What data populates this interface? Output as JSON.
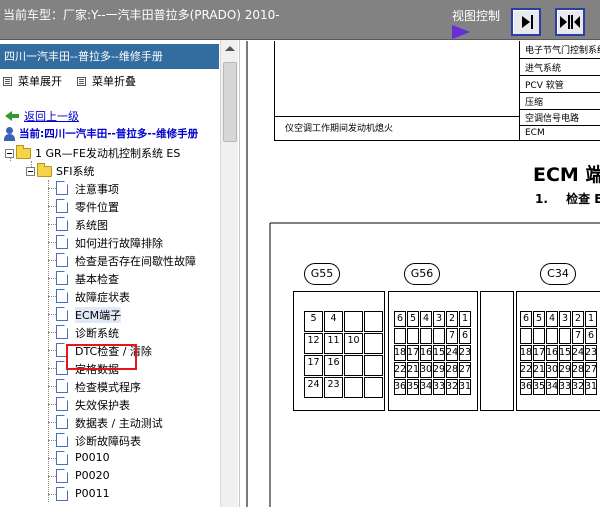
{
  "topbar": {
    "vehicle_label": "当前车型：厂家:Y--一汽丰田普拉多(PRADO) 2010-",
    "view_control_label": "视图控制",
    "btn_prev_icon": "arrow-right-bar-icon",
    "btn_fit_icon": "arrows-inward-icon"
  },
  "left_panel": {
    "header": "四川一汽丰田--普拉多--维修手册",
    "expand_label": "菜单展开",
    "collapse_label": "菜单折叠",
    "back_label": "返回上一级",
    "current_label": "当前:四川一汽丰田--普拉多--维修手册",
    "tree": {
      "root": "1 GR—FE发动机控制系统 ES",
      "folder": "SFI系统",
      "items": [
        "注意事项",
        "零件位置",
        "系统图",
        "如何进行故障排除",
        "检查是否存在间歇性故障",
        "基本检查",
        "故障症状表",
        "ECM端子",
        "诊断系统",
        "DTC检查 / 清除",
        "定格数据",
        "检查模式程序",
        "失效保护表",
        "数据表 / 主动测试",
        "诊断故障码表",
        "P0010",
        "P0020",
        "P0011"
      ],
      "selected_index": 7
    }
  },
  "document": {
    "spec_right": [
      "电子节气门控制系统",
      "进气系统",
      "PCV 软管",
      "压缩",
      "空调信号电路",
      "ECM"
    ],
    "spec_left": "仪空调工作期间发动机熄火",
    "title": "ECM 端",
    "step_num": "1.",
    "step_text": "检查 E",
    "connectors": [
      "G55",
      "G56",
      "C34"
    ],
    "g55_pins": [
      "5",
      "4",
      "",
      "",
      "12",
      "11",
      "10",
      "",
      "17",
      "16",
      "",
      "",
      "24",
      "23",
      "",
      ""
    ],
    "g56_pins": [
      "6",
      "5",
      "4",
      "3",
      "2",
      "1",
      "",
      "",
      "",
      "",
      "7",
      "6",
      "18",
      "17",
      "16",
      "15",
      "24",
      "23",
      "22",
      "21",
      "30",
      "29",
      "28",
      "27",
      "36",
      "35",
      "34",
      "33",
      "32",
      "31"
    ],
    "c34_pins": [
      "6",
      "5",
      "4",
      "3",
      "2",
      "1",
      "",
      "",
      "",
      "",
      "7",
      "6",
      "18",
      "17",
      "16",
      "15",
      "24",
      "23",
      "22",
      "21",
      "30",
      "29",
      "28",
      "27",
      "36",
      "35",
      "34",
      "33",
      "32",
      "31"
    ]
  }
}
